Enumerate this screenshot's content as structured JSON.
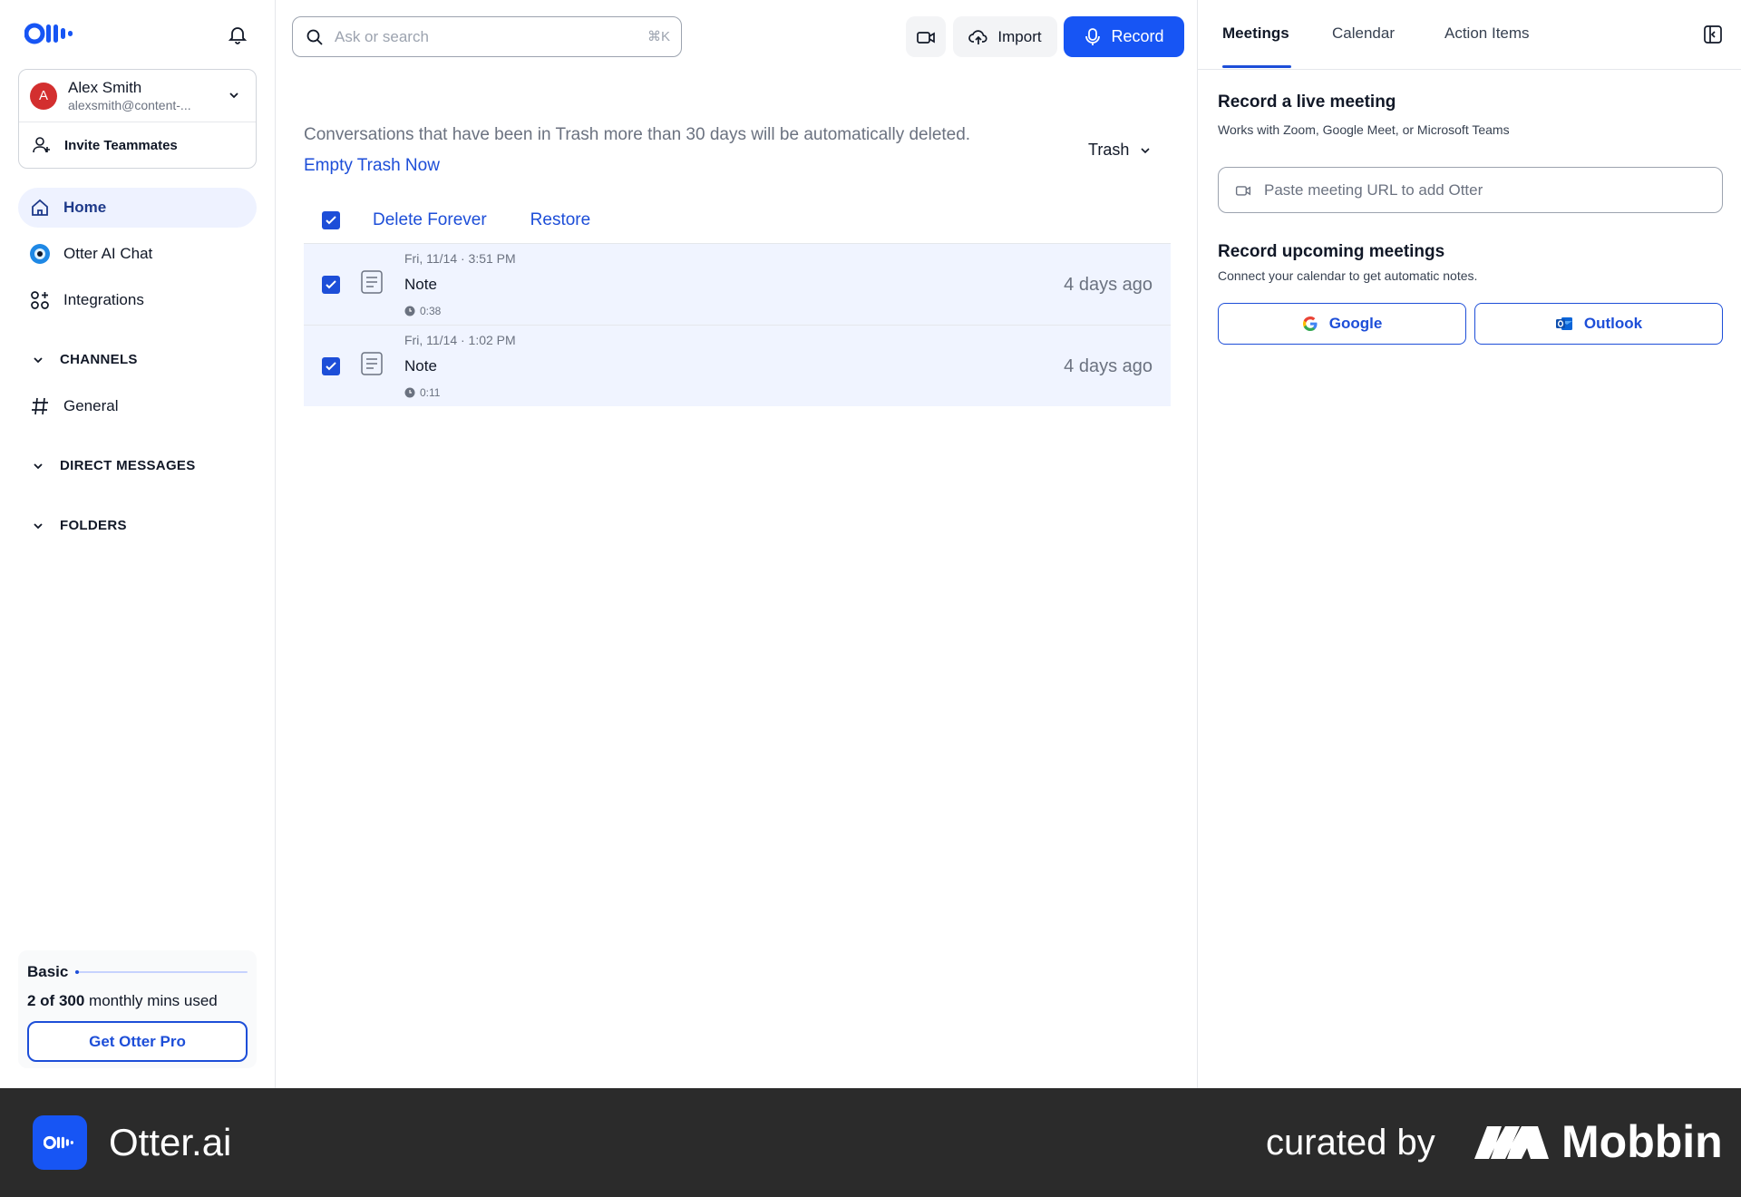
{
  "sidebar": {
    "account": {
      "initial": "A",
      "name": "Alex Smith",
      "email": "alexsmith@content-..."
    },
    "invite_label": "Invite Teammates",
    "nav": [
      {
        "label": "Home",
        "icon": "home-icon",
        "active": true
      },
      {
        "label": "Otter AI Chat",
        "icon": "otter-chat-icon"
      },
      {
        "label": "Integrations",
        "icon": "integrations-icon"
      }
    ],
    "sections": {
      "channels": "CHANNELS",
      "channel_general": "General",
      "direct_messages": "DIRECT MESSAGES",
      "folders": "FOLDERS"
    },
    "plan": {
      "name": "Basic",
      "used": "2 of 300",
      "used_suffix": " monthly mins used",
      "used_fraction": 0.0067,
      "cta": "Get Otter Pro"
    }
  },
  "topbar": {
    "search_placeholder": "Ask or search",
    "search_shortcut": "⌘K",
    "import_label": "Import",
    "record_label": "Record"
  },
  "trash": {
    "notice": "Conversations that have been in Trash more than 30 days will be automatically deleted.",
    "empty_now": "Empty Trash Now",
    "filter_label": "Trash",
    "actions": {
      "delete_forever": "Delete Forever",
      "restore": "Restore"
    },
    "items": [
      {
        "date": "Fri, 11/14 · 3:51 PM",
        "title": "Note",
        "duration": "0:38",
        "ago": "4 days ago"
      },
      {
        "date": "Fri, 11/14 · 1:02 PM",
        "title": "Note",
        "duration": "0:11",
        "ago": "4 days ago"
      }
    ]
  },
  "right_panel": {
    "tabs": [
      "Meetings",
      "Calendar",
      "Action Items"
    ],
    "live": {
      "title": "Record a live meeting",
      "subtitle": "Works with Zoom, Google Meet, or Microsoft Teams",
      "url_placeholder": "Paste meeting URL to add Otter"
    },
    "upcoming": {
      "title": "Record upcoming meetings",
      "subtitle": "Connect your calendar to get automatic notes.",
      "google": "Google",
      "outlook": "Outlook"
    }
  },
  "footer": {
    "app_name": "Otter.ai",
    "curated": "curated by",
    "brand": "Mobbin"
  },
  "colors": {
    "accent": "#1755f4",
    "link": "#1d4ed8",
    "selected_row": "#f0f4ff",
    "avatar": "#d32f2f"
  }
}
